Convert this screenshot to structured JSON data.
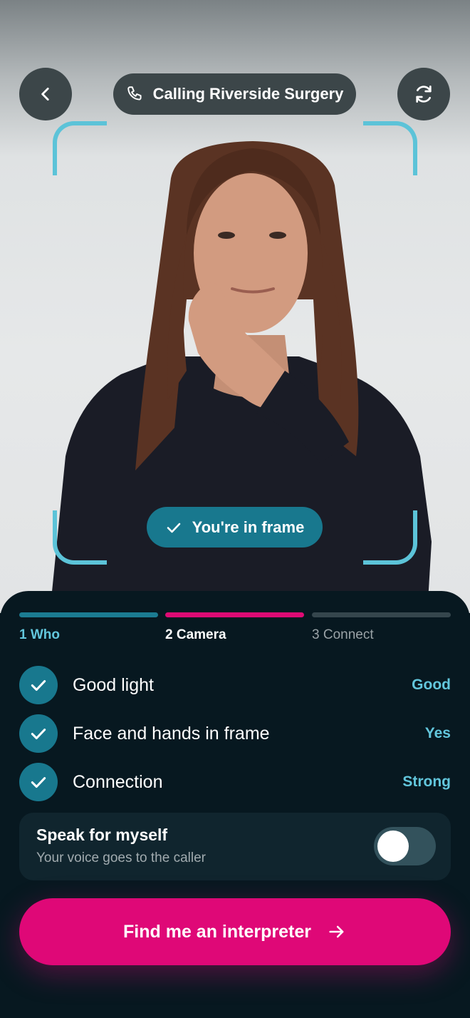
{
  "header": {
    "call_label": "Calling Riverside Surgery",
    "back_icon": "chevron-left-icon",
    "call_icon": "phone-icon",
    "flip_icon": "refresh-camera-icon"
  },
  "camera": {
    "frame_status": "You're in frame",
    "frame_color": "#5cc3d8"
  },
  "steps": [
    {
      "label": "1 Who",
      "state": "done"
    },
    {
      "label": "2 Camera",
      "state": "active"
    },
    {
      "label": "3 Connect",
      "state": "upcoming"
    }
  ],
  "checks": [
    {
      "label": "Good light",
      "status": "Good"
    },
    {
      "label": "Face and hands in frame",
      "status": "Yes"
    },
    {
      "label": "Connection",
      "status": "Strong"
    }
  ],
  "voice_toggle": {
    "title": "Speak for myself",
    "subtitle": "Your voice goes to the caller",
    "on": false
  },
  "cta": {
    "label": "Find me an interpreter",
    "icon": "arrow-right-icon"
  },
  "colors": {
    "accent": "#df0877",
    "teal": "#18788e",
    "teal_light": "#62c6dc",
    "sheet_bg": "#071820"
  }
}
